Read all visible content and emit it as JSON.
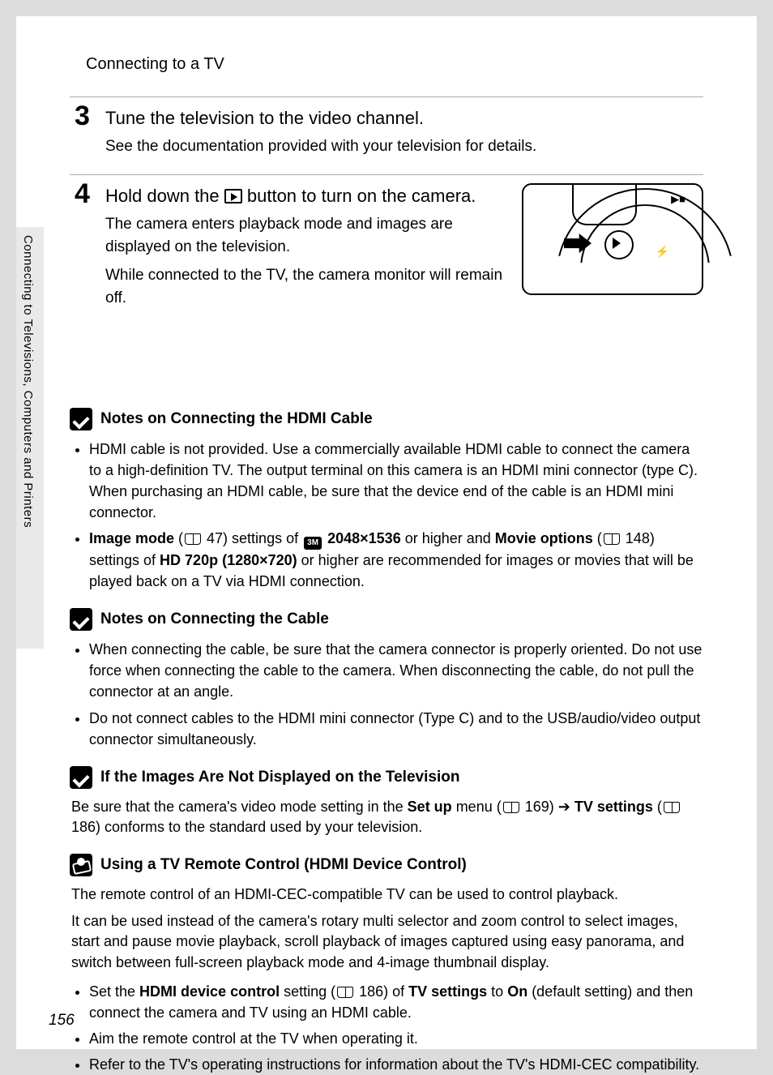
{
  "header": {
    "title": "Connecting to a TV"
  },
  "sideTab": "Connecting to Televisions, Computers and Printers",
  "pageNumber": "156",
  "steps": {
    "s3": {
      "num": "3",
      "title": "Tune the television to the video channel.",
      "text": "See the documentation provided with your television for details."
    },
    "s4": {
      "num": "4",
      "title_a": "Hold down the ",
      "title_b": " button to turn on the camera.",
      "p1": "The camera enters playback mode and images are displayed on the television.",
      "p2": "While connected to the TV, the camera monitor will remain off."
    }
  },
  "notes": {
    "hdmi": {
      "title": "Notes on Connecting the HDMI Cable",
      "b1": "HDMI cable is not provided. Use a commercially available HDMI cable to connect the camera to a high-definition TV. The output terminal on this camera is an HDMI mini connector (type C). When purchasing an HDMI cable, be sure that the device end of the cable is an HDMI mini connector.",
      "b2_a": "Image mode",
      "b2_b": " 47) settings of ",
      "b2_c": " 2048×1536",
      "b2_d": " or higher and ",
      "b2_e": "Movie options",
      "b2_f": " 148) settings of ",
      "b2_g": "HD 720p (1280×720)",
      "b2_h": " or higher are recommended for images or movies that will be played back on a TV via HDMI connection."
    },
    "cable": {
      "title": "Notes on Connecting the Cable",
      "b1": "When connecting the cable, be sure that the camera connector is properly oriented. Do not use force when connecting the cable to the camera. When disconnecting the cable, do not pull the connector at an angle.",
      "b2": "Do not connect cables to the HDMI mini connector (Type C) and to the USB/audio/video output connector simultaneously."
    },
    "notv": {
      "title": "If the Images Are Not Displayed on the Television",
      "p_a": "Be sure that the camera's video mode setting in the ",
      "p_b": "Set up",
      "p_c": " menu (",
      "p_d": " 169) ➔ ",
      "p_e": "TV settings",
      "p_f": " 186) conforms to the standard used by your television."
    },
    "remote": {
      "title": "Using a TV Remote Control (HDMI Device Control)",
      "p1": "The remote control of an HDMI-CEC-compatible TV can be used to control playback.",
      "p2": "It can be used instead of the camera's rotary multi selector and zoom control to select images, start and pause movie playback, scroll playback of images captured using easy panorama, and switch between full-screen playback mode and 4-image thumbnail display.",
      "b1_a": "Set the ",
      "b1_b": "HDMI device control",
      "b1_c": " setting (",
      "b1_d": " 186) of ",
      "b1_e": "TV settings",
      "b1_f": " to ",
      "b1_g": "On",
      "b1_h": " (default setting) and then connect the camera and TV using an HDMI cable.",
      "b2": "Aim the remote control at the TV when operating it.",
      "b3": "Refer to the TV's operating instructions for information about the TV's HDMI-CEC compatibility."
    }
  },
  "modeIconLabel": "3M"
}
